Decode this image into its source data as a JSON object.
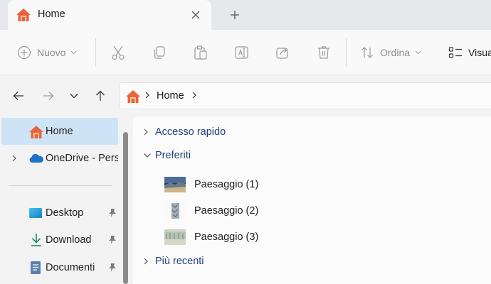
{
  "tab": {
    "title": "Home"
  },
  "toolbar": {
    "new_label": "Nuovo",
    "sort_label": "Ordina",
    "view_label": "Visua"
  },
  "address": {
    "crumb": "Home"
  },
  "sidebar": {
    "items": [
      {
        "label": "Home",
        "icon": "home-icon"
      },
      {
        "label": "OneDrive - Perso",
        "icon": "onedrive-cloud-icon"
      },
      {
        "label": "Desktop",
        "icon": "desktop-icon"
      },
      {
        "label": "Download",
        "icon": "download-icon"
      },
      {
        "label": "Documenti",
        "icon": "documents-icon"
      }
    ]
  },
  "content": {
    "groups": [
      {
        "label": "Accesso rapido",
        "expanded": false
      },
      {
        "label": "Preferiti",
        "expanded": true
      },
      {
        "label": "Più recenti",
        "expanded": false
      }
    ],
    "files": [
      {
        "name": "Paesaggio (1)"
      },
      {
        "name": "Paesaggio (2)"
      },
      {
        "name": "Paesaggio (3)"
      }
    ]
  },
  "colors": {
    "accent": "#24407a",
    "selected_bg": "#cfe3f6",
    "home_roof": "#e8643c",
    "onedrive": "#1a73c8"
  }
}
